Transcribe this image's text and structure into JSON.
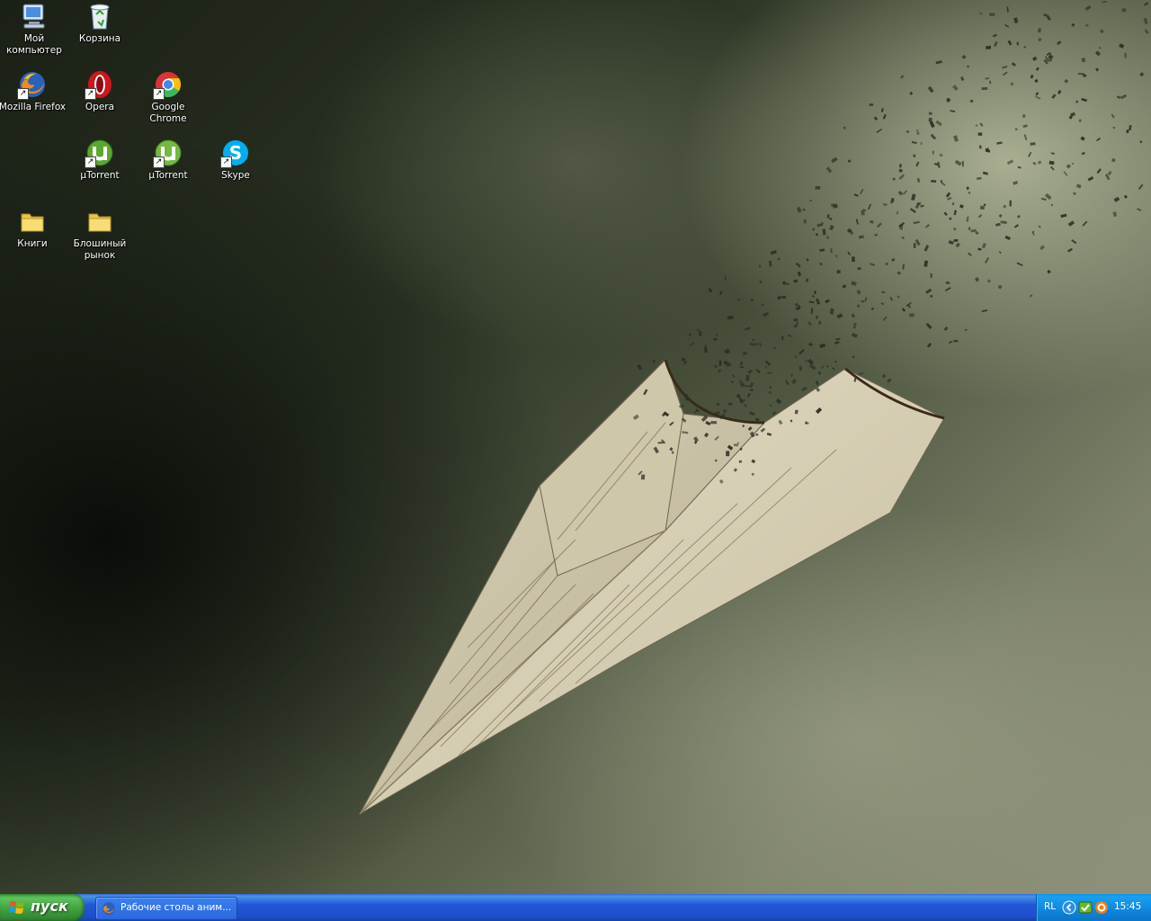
{
  "desktop": {
    "icons": [
      {
        "label": "Мой\nкомпьютер",
        "icon": "my-computer-icon"
      },
      {
        "label": "Корзина",
        "icon": "recycle-bin-icon"
      },
      {
        "label": "Mozilla Firefox",
        "icon": "firefox-icon"
      },
      {
        "label": "Opera",
        "icon": "opera-icon"
      },
      {
        "label": "Google\nChrome",
        "icon": "chrome-icon"
      },
      {
        "label": "µTorrent",
        "icon": "utorrent-icon"
      },
      {
        "label": "µTorrent",
        "icon": "utorrent-icon"
      },
      {
        "label": "Skype",
        "icon": "skype-icon"
      },
      {
        "label": "Книги",
        "icon": "folder-icon"
      },
      {
        "label": "Блошиный\nрынок",
        "icon": "folder-icon"
      }
    ]
  },
  "taskbar": {
    "start_label": "пуск",
    "tasks": [
      {
        "label": "Рабочие столы аним...",
        "icon": "firefox-icon"
      }
    ],
    "tray": {
      "language": "RL",
      "clock": "15:45",
      "icons": [
        "show-hidden-icons-chevron-icon",
        "security-shield-icon",
        "avast-icon"
      ]
    }
  },
  "colors": {
    "taskbar_blue": "#2157d7",
    "start_green": "#3e9e3e",
    "tray_blue": "#0f86dd",
    "desktop_label": "#ffffff"
  }
}
